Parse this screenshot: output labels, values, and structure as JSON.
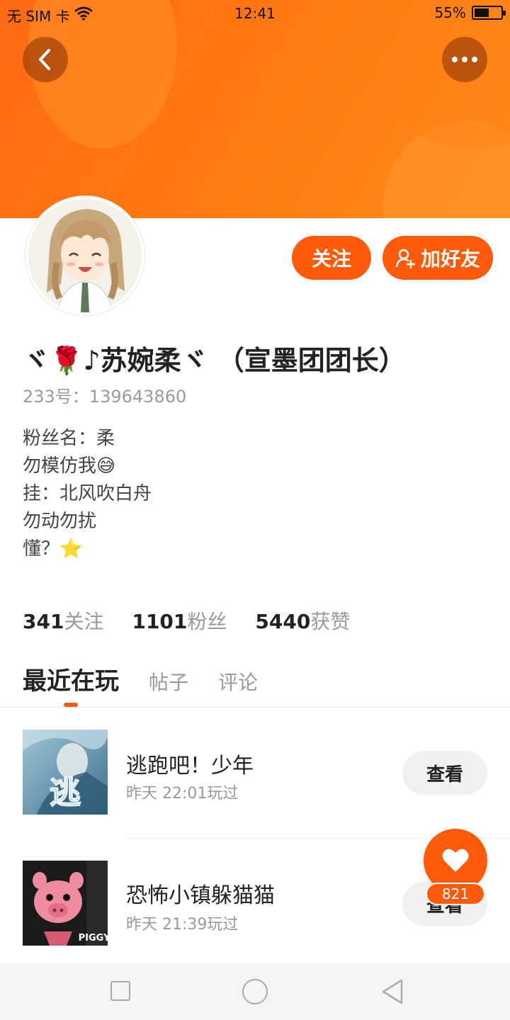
{
  "status_bar": {
    "carrier": "无 SIM 卡",
    "time": "12:41",
    "battery": "55%",
    "battery_level": 0.55
  },
  "header": {
    "back_icon": "chevron-left-icon",
    "more_icon": "more-dots-icon"
  },
  "profile": {
    "username": "ヾ🌹♪苏婉柔ヾ （宣墨团团长）",
    "uid": "233号：139643860",
    "bio": [
      "粉丝名：柔",
      "勿模仿我😅",
      "挂：北风吹白舟",
      "勿动勿扰",
      "懂？⭐"
    ]
  },
  "actions": {
    "follow": "关注",
    "add_friend": "加好友"
  },
  "stats": [
    {
      "value": "341",
      "label": "关注"
    },
    {
      "value": "1101",
      "label": "粉丝"
    },
    {
      "value": "5440",
      "label": "获赞"
    }
  ],
  "tabs": [
    "最近在玩",
    "帖子",
    "评论"
  ],
  "games": [
    {
      "name": "逃跑吧！少年",
      "time": "昨天 22:01玩过",
      "button": "查看",
      "thumb_text": "逃"
    },
    {
      "name": "恐怖小镇躲猫猫",
      "time": "昨天 21:39玩过",
      "button": "查看",
      "thumb_text": "PIGGY"
    }
  ],
  "like": {
    "count": "821"
  },
  "colors": {
    "accent": "#ff5a0a",
    "banner": "#ff7a10"
  }
}
